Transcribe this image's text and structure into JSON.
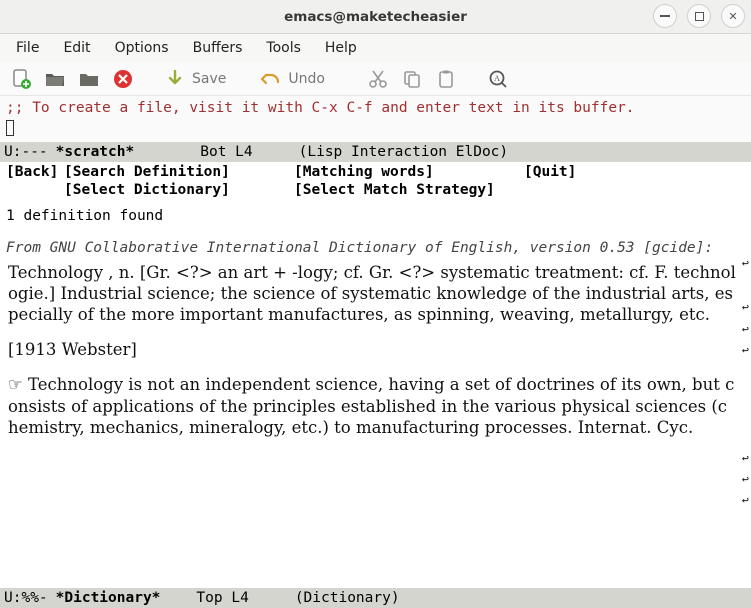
{
  "window": {
    "title": "emacs@maketecheasier"
  },
  "menubar": [
    "File",
    "Edit",
    "Options",
    "Buffers",
    "Tools",
    "Help"
  ],
  "toolbar": {
    "save_label": "Save",
    "undo_label": "Undo"
  },
  "scratch": {
    "comment": ";; To create a file, visit it with C-x C-f and enter text in its buffer."
  },
  "modeline1": {
    "left": "U:---",
    "buffer": "*scratch*",
    "pos": "Bot L4",
    "mode": "(Lisp Interaction ElDoc)"
  },
  "dict_header": {
    "back": "[Back]",
    "search": "[Search Definition]",
    "match": "[Matching words]",
    "quit": "[Quit]",
    "select_dict": "[Select Dictionary]",
    "select_strat": "[Select Match Strategy]"
  },
  "dict": {
    "count": "1 definition found",
    "source": "From GNU Collaborative International Dictionary of English, version 0.53 [gcide]:",
    "def1": "Technology , n. [Gr. <?> an art + -logy; cf. Gr. <?> systematic treatment: cf. F. technologie.] Industrial science; the science of systematic knowledge of the industrial arts, especially of the more important manufactures, as spinning, weaving, metallurgy, etc.",
    "ref1": "[1913 Webster]",
    "def2": "☞ Technology is not an independent science, having a set of doctrines of its own, but consists of applications of the principles established in the various physical sciences (chemistry, mechanics, mineralogy, etc.) to manufacturing processes.  Internat. Cyc."
  },
  "modeline2": {
    "left": "U:%%-",
    "buffer": "*Dictionary*",
    "pos": "Top L4",
    "mode": "(Dictionary)"
  },
  "icons": {
    "new": "new-file-icon",
    "open": "open-folder-icon",
    "dir": "folder-icon",
    "kill": "close-circle-icon",
    "save": "save-arrow-icon",
    "undo": "undo-icon",
    "cut": "scissors-icon",
    "copy": "copy-icon",
    "paste": "paste-icon",
    "search": "search-icon"
  }
}
